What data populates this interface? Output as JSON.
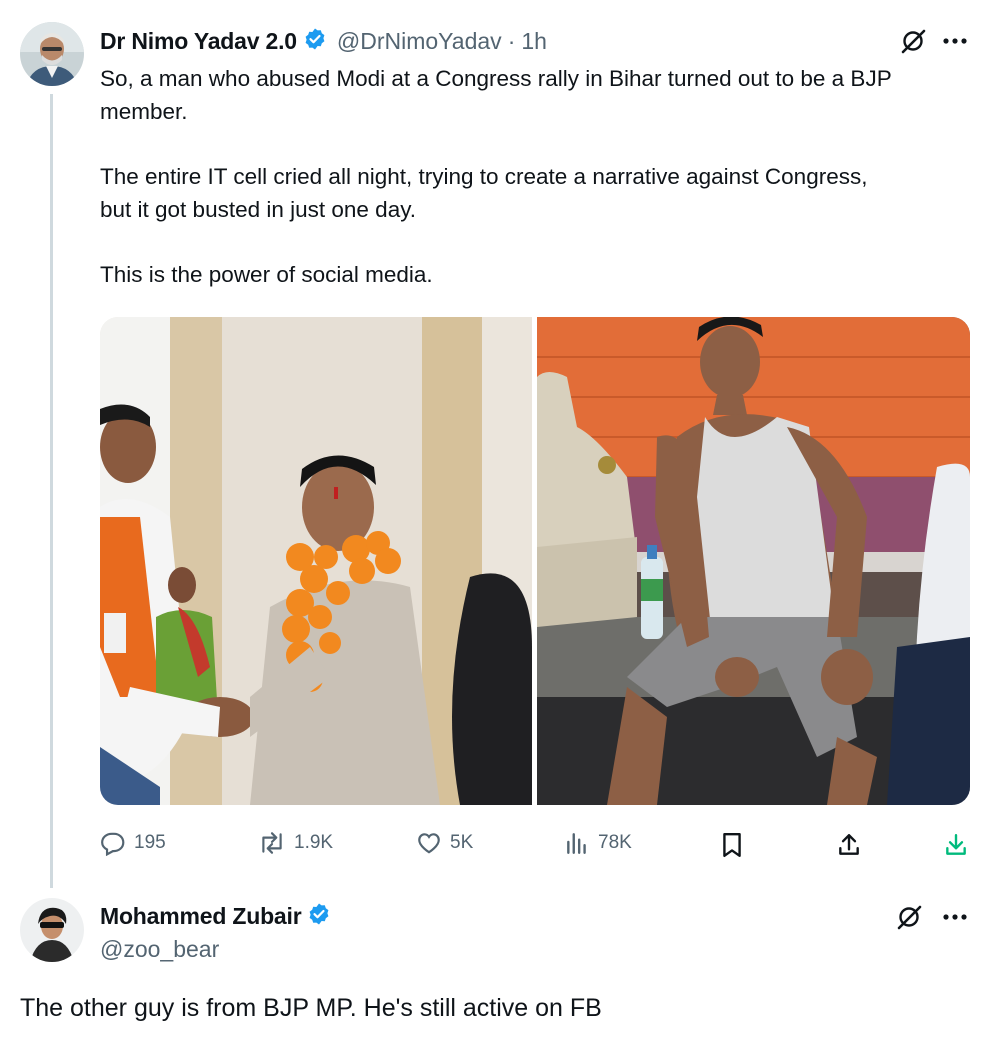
{
  "tweet": {
    "author_name": "Dr Nimo Yadav 2.0",
    "author_handle": "@DrNimoYadav",
    "separator": "·",
    "time": "1h",
    "paragraphs": [
      "So, a man who abused Modi at a Congress rally in Bihar turned out to be a BJP member.",
      "The entire IT cell cried all night, trying to create a narrative against Congress, but it got busted in just one day.",
      "This is the power of social media."
    ],
    "stats": {
      "replies": "195",
      "reposts": "1.9K",
      "likes": "5K",
      "views": "78K"
    }
  },
  "reply": {
    "author_name": "Mohammed Zubair",
    "author_handle": "@zoo_bear",
    "text": "The other guy is from BJP MP. He's still active on FB"
  },
  "icons": {
    "verified": "verified-badge-icon",
    "grok": "grok-icon",
    "more": "more-icon",
    "reply": "reply-icon",
    "repost": "repost-icon",
    "like": "like-icon",
    "views": "views-icon",
    "bookmark": "bookmark-icon",
    "share": "share-icon",
    "download": "download-icon"
  },
  "colors": {
    "verified_blue": "#1d9bf0",
    "secondary_text": "#536471",
    "download_green": "#00ba7c",
    "thread_line": "#cfd9de"
  }
}
